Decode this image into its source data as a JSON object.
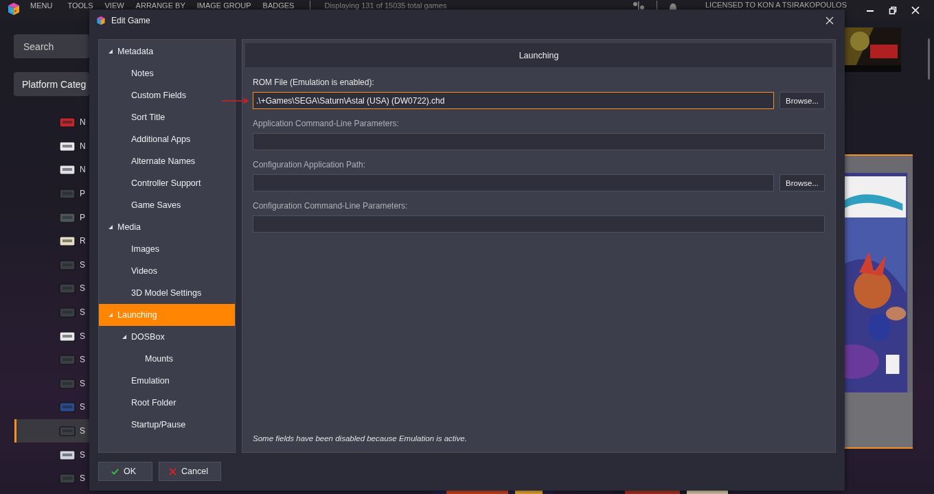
{
  "app_menu": [
    "MENU",
    "TOOLS",
    "VIEW",
    "ARRANGE BY",
    "IMAGE GROUP",
    "BADGES"
  ],
  "status_text": "Displaying 131 of 15035 total games",
  "license_text": "LICENSED TO KON A TSIRAKOPOULOS",
  "sidebar": {
    "search": {
      "placeholder": "Search"
    },
    "category_button": "Platform Categ",
    "items": [
      {
        "label": "N",
        "selected": false
      },
      {
        "label": "N",
        "selected": false
      },
      {
        "label": "N",
        "selected": false
      },
      {
        "label": "P",
        "selected": false
      },
      {
        "label": "P",
        "selected": false
      },
      {
        "label": "R",
        "selected": false
      },
      {
        "label": "S",
        "selected": false
      },
      {
        "label": "S",
        "selected": false
      },
      {
        "label": "S",
        "selected": false
      },
      {
        "label": "S",
        "selected": false
      },
      {
        "label": "S",
        "selected": false
      },
      {
        "label": "S",
        "selected": false
      },
      {
        "label": "S",
        "selected": false
      },
      {
        "label": "S",
        "selected": true
      },
      {
        "label": "S",
        "selected": false
      },
      {
        "label": "S",
        "selected": false
      }
    ]
  },
  "dialog": {
    "title": "Edit Game",
    "tree": [
      {
        "label": "Metadata",
        "selected": false,
        "expanded": true,
        "children": [
          {
            "label": "Notes",
            "selected": false
          },
          {
            "label": "Custom Fields",
            "selected": false
          },
          {
            "label": "Sort Title",
            "selected": false
          },
          {
            "label": "Additional Apps",
            "selected": false
          },
          {
            "label": "Alternate Names",
            "selected": false
          },
          {
            "label": "Controller Support",
            "selected": false
          },
          {
            "label": "Game Saves",
            "selected": false
          }
        ]
      },
      {
        "label": "Media",
        "selected": false,
        "expanded": true,
        "children": [
          {
            "label": "Images",
            "selected": false
          },
          {
            "label": "Videos",
            "selected": false
          },
          {
            "label": "3D Model Settings",
            "selected": false
          }
        ]
      },
      {
        "label": "Launching",
        "selected": true,
        "expanded": true,
        "children": [
          {
            "label": "DOSBox",
            "selected": false,
            "expanded": true,
            "children": [
              {
                "label": "Mounts",
                "selected": false
              }
            ]
          },
          {
            "label": "Emulation",
            "selected": false
          },
          {
            "label": "Root Folder",
            "selected": false
          },
          {
            "label": "Startup/Pause",
            "selected": false
          }
        ]
      }
    ],
    "section_title": "Launching",
    "fields": [
      {
        "label": "ROM File (Emulation is enabled):",
        "value": ".\\+Games\\SEGA\\Saturn\\Astal (USA) (DW0722).chd",
        "focused": true,
        "disabled": false,
        "button": "Browse..."
      },
      {
        "label": "Application Command-Line Parameters:",
        "focused": false,
        "disabled": true
      },
      {
        "label": "Configuration Application Path:",
        "focused": false,
        "disabled": true,
        "button": "Browse..."
      },
      {
        "label": "Configuration Command-Line Parameters:",
        "focused": false,
        "disabled": true
      }
    ],
    "note": "Some fields have been disabled because Emulation is active.",
    "buttons": [
      {
        "label": "OK",
        "kind": "ok"
      },
      {
        "label": "Cancel",
        "kind": "cancel"
      }
    ]
  }
}
